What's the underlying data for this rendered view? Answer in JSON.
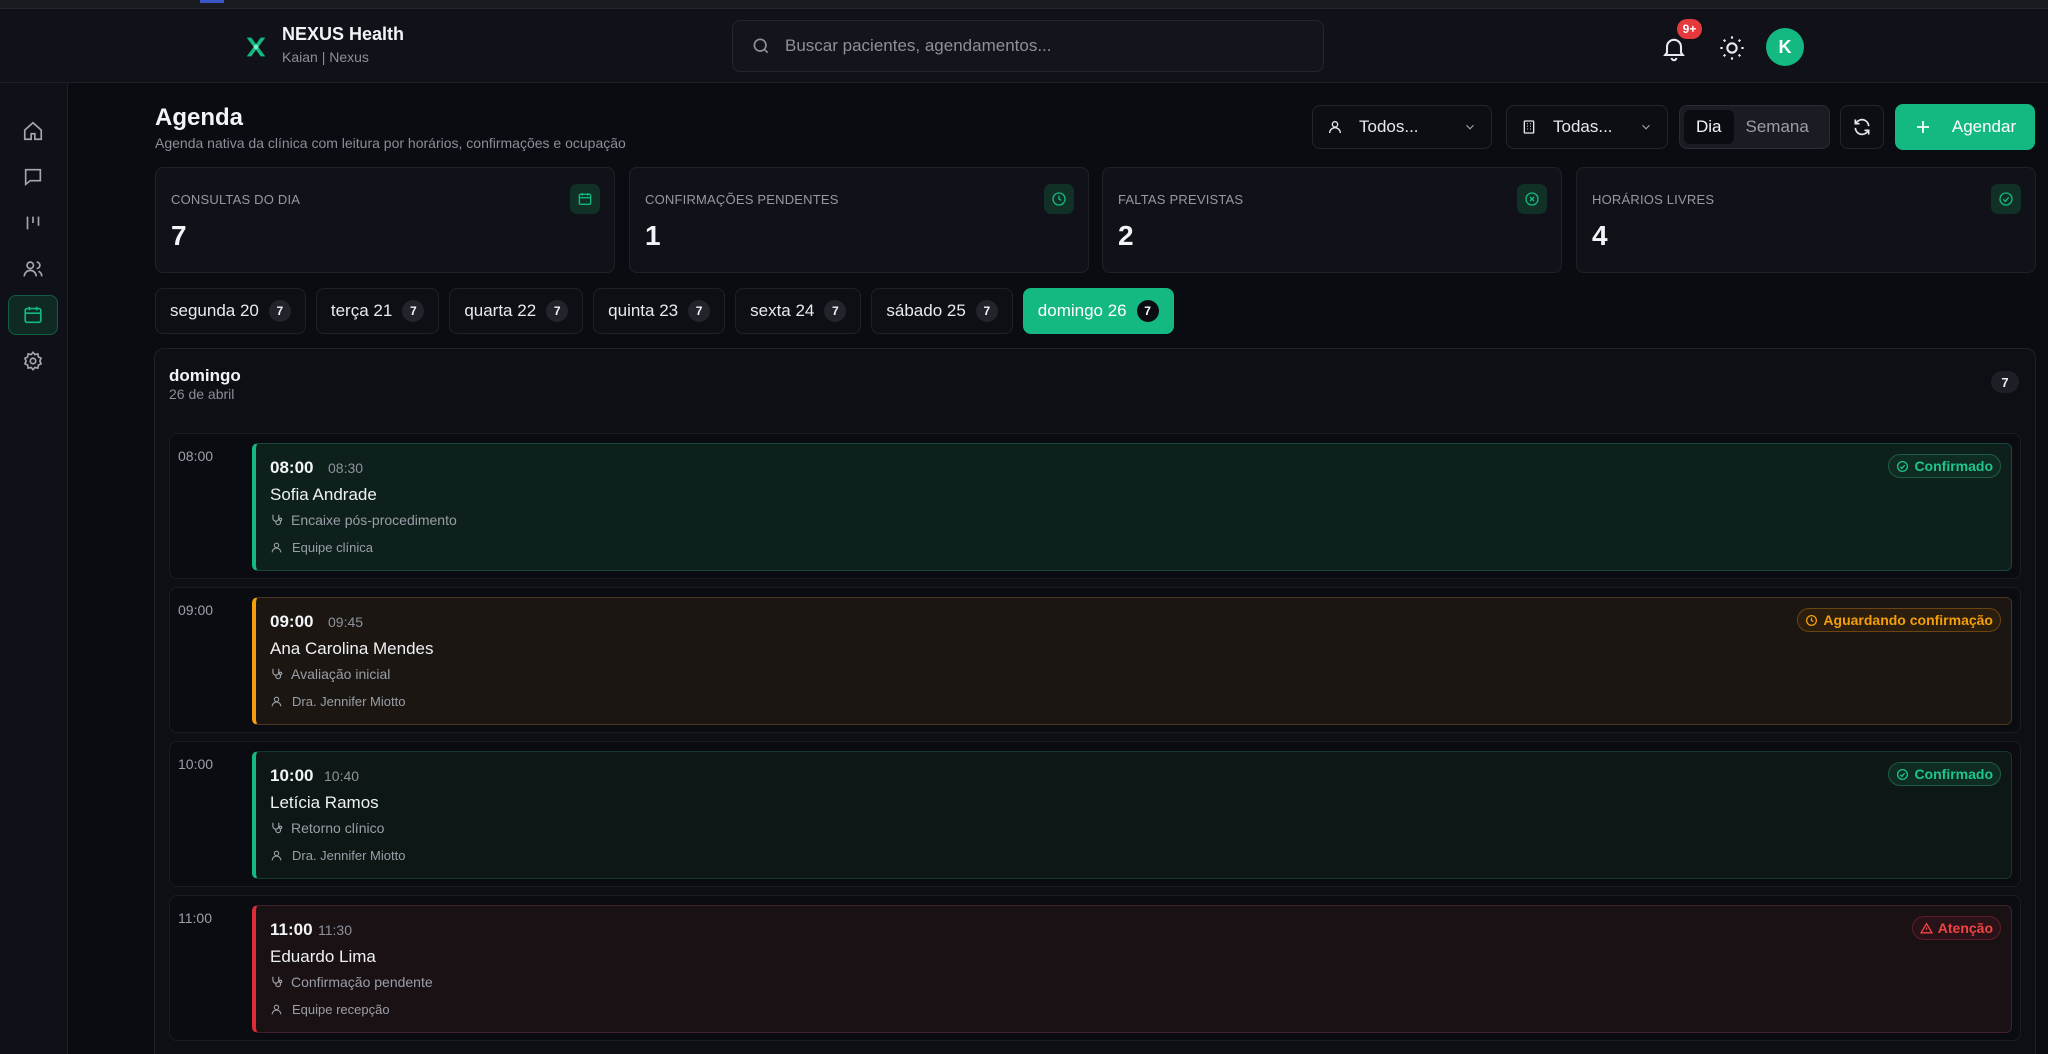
{
  "brand": {
    "name": "NEXUS Health",
    "sub": "Kaian | Nexus"
  },
  "search": {
    "placeholder": "Buscar pacientes, agendamentos..."
  },
  "notifications": {
    "badge": "9+"
  },
  "user": {
    "initial": "K"
  },
  "sidebar": {
    "items": [
      {
        "name": "home",
        "icon": "home-icon"
      },
      {
        "name": "messages",
        "icon": "chat-icon"
      },
      {
        "name": "pipeline",
        "icon": "kanban-icon"
      },
      {
        "name": "patients",
        "icon": "users-icon"
      },
      {
        "name": "agenda",
        "icon": "calendar-icon",
        "active": true
      },
      {
        "name": "settings",
        "icon": "gear-icon"
      }
    ]
  },
  "page": {
    "title": "Agenda",
    "subtitle": "Agenda nativa da clínica com leitura por horários, confirmações e ocupação"
  },
  "toolbar": {
    "professional_filter": "Todos...",
    "unit_filter": "Todas...",
    "view_day": "Dia",
    "view_week": "Semana",
    "new_label": "Agendar"
  },
  "stats": [
    {
      "label": "CONSULTAS DO DIA",
      "value": "7",
      "icon": "calendar-icon"
    },
    {
      "label": "CONFIRMAÇÕES PENDENTES",
      "value": "1",
      "icon": "clock-icon"
    },
    {
      "label": "FALTAS PREVISTAS",
      "value": "2",
      "icon": "x-circle-icon"
    },
    {
      "label": "HORÁRIOS LIVRES",
      "value": "4",
      "icon": "check-circle-icon"
    }
  ],
  "days": [
    {
      "label": "segunda 20",
      "count": "7"
    },
    {
      "label": "terça 21",
      "count": "7"
    },
    {
      "label": "quarta 22",
      "count": "7"
    },
    {
      "label": "quinta 23",
      "count": "7"
    },
    {
      "label": "sexta 24",
      "count": "7"
    },
    {
      "label": "sábado 25",
      "count": "7"
    },
    {
      "label": "domingo 26",
      "count": "7",
      "active": true
    }
  ],
  "panel": {
    "day": "domingo",
    "date": "26 de abril",
    "count": "7"
  },
  "slots": [
    {
      "time": "08:00",
      "start": "08:00",
      "end": "08:30",
      "patient": "Sofia Andrade",
      "procedure": "Encaixe pós-procedimento",
      "professional": "Equipe clínica",
      "status": "Confirmado",
      "tone": "green"
    },
    {
      "time": "09:00",
      "start": "09:00",
      "end": "09:45",
      "patient": "Ana Carolina Mendes",
      "procedure": "Avaliação inicial",
      "professional": "Dra. Jennifer Miotto",
      "status": "Aguardando confirmação",
      "tone": "orange"
    },
    {
      "time": "10:00",
      "start": "10:00",
      "end": "10:40",
      "patient": "Letícia Ramos",
      "procedure": "Retorno clínico",
      "professional": "Dra. Jennifer Miotto",
      "status": "Confirmado",
      "tone": "green"
    },
    {
      "time": "11:00",
      "start": "11:00",
      "end": "11:30",
      "patient": "Eduardo Lima",
      "procedure": "Confirmação pendente",
      "professional": "Equipe recepção",
      "status": "Atenção",
      "tone": "red"
    }
  ],
  "colors": {
    "accent": "#14b981",
    "warning": "#f59e0b",
    "danger": "#dc2c38",
    "background": "#0b0c11"
  }
}
